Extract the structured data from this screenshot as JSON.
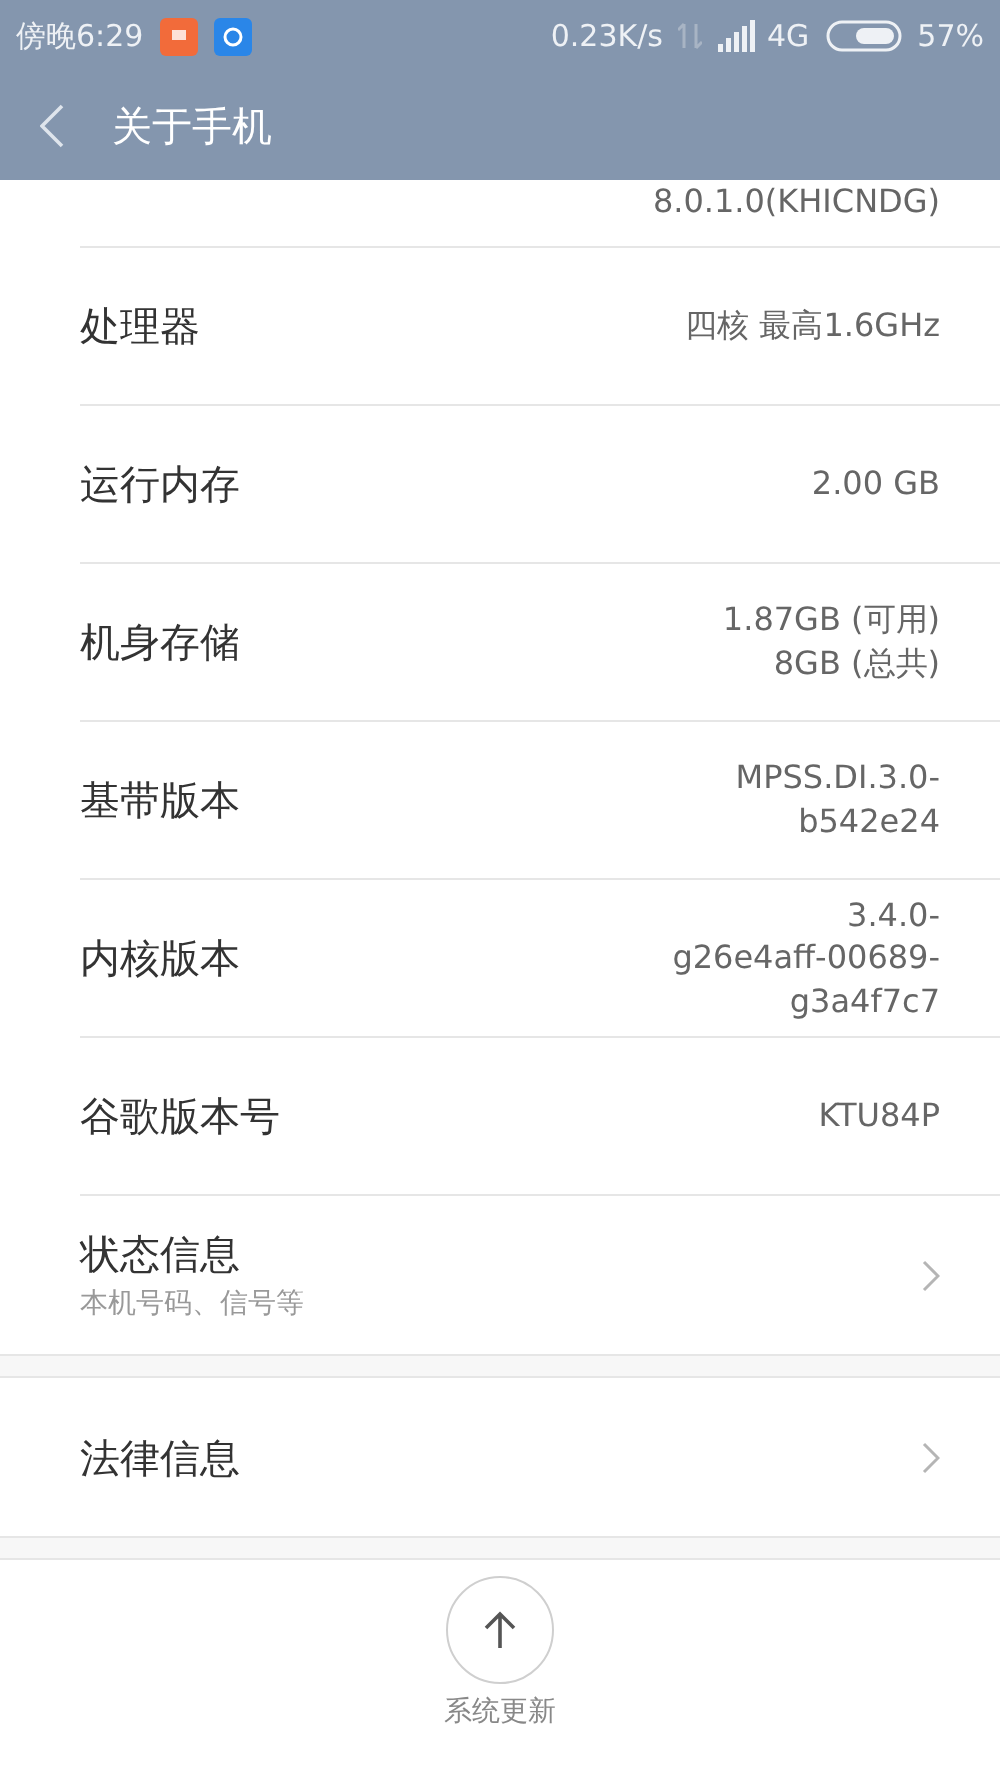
{
  "status_bar": {
    "time": "傍晚6:29",
    "speed": "0.23K/s",
    "network": "4G",
    "battery": "57%"
  },
  "title_bar": {
    "title": "关于手机"
  },
  "sections": [
    {
      "rows": [
        {
          "kind": "cut",
          "value_lines": [
            "8.0.1.0(KHICNDG)"
          ]
        },
        {
          "kind": "info",
          "label": "处理器",
          "value_lines": [
            "四核 最高1.6GHz"
          ]
        },
        {
          "kind": "info",
          "label": "运行内存",
          "value_lines": [
            "2.00 GB"
          ]
        },
        {
          "kind": "info",
          "label": "机身存储",
          "value_lines": [
            "1.87GB (可用)",
            "8GB (总共)"
          ]
        },
        {
          "kind": "info",
          "label": "基带版本",
          "value_lines": [
            "MPSS.DI.3.0-",
            "b542e24"
          ]
        },
        {
          "kind": "info",
          "label": "内核版本",
          "value_lines": [
            "3.4.0-",
            "g26e4aff-00689-",
            "g3a4f7c7"
          ]
        },
        {
          "kind": "info",
          "label": "谷歌版本号",
          "value_lines": [
            "KTU84P"
          ]
        },
        {
          "kind": "link",
          "label": "状态信息",
          "subtitle": "本机号码、信号等"
        }
      ]
    },
    {
      "rows": [
        {
          "kind": "link",
          "label": "法律信息"
        }
      ]
    }
  ],
  "bottom_action": {
    "label": "系统更新"
  }
}
